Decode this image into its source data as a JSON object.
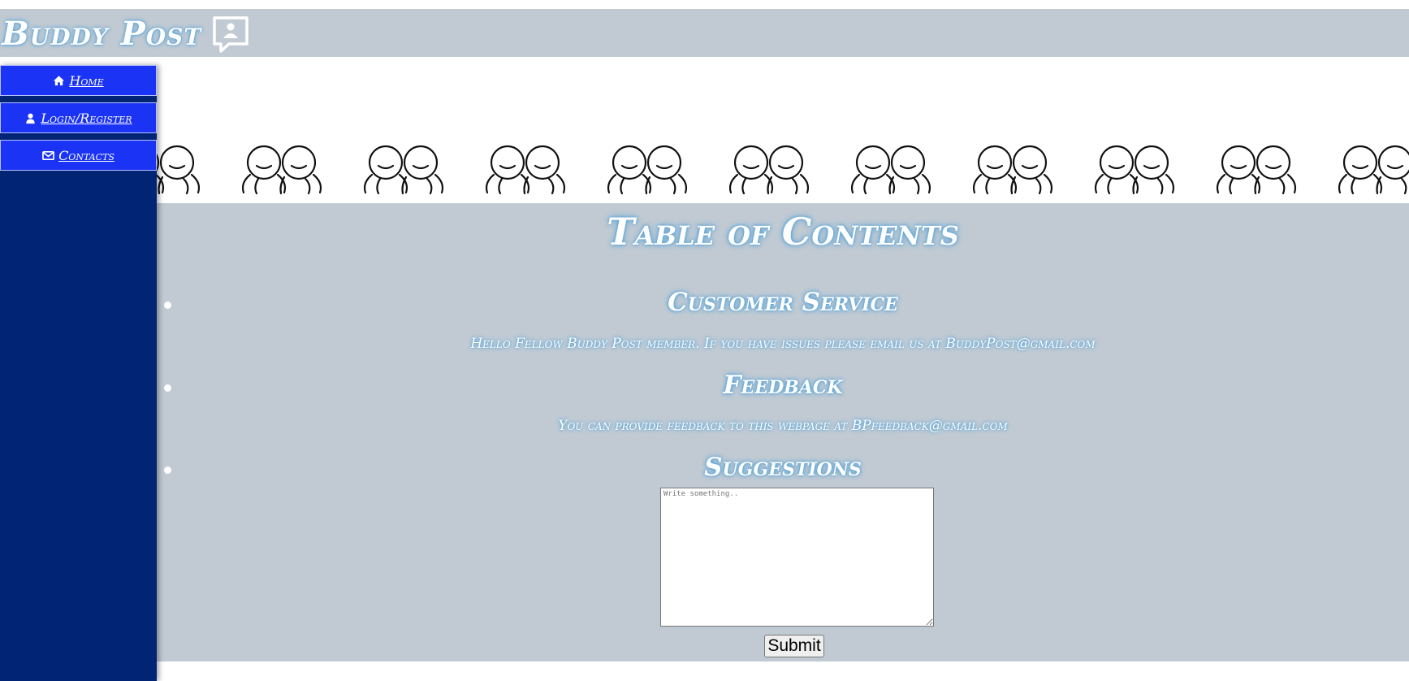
{
  "brand": {
    "title": "Buddy Post",
    "icon": "contact-card-chat-icon"
  },
  "nav": {
    "items": [
      {
        "label": "Home",
        "icon": "home-icon"
      },
      {
        "label": " Login/Register",
        "icon": "user-icon"
      },
      {
        "label": " Contacts",
        "icon": "envelope-icon"
      }
    ]
  },
  "main": {
    "title": "Table of Contents",
    "sections": [
      {
        "heading": "Customer Service",
        "text": "Hello Fellow Buddy Post member. If you have issues please email us at BuddyPost@gmail.com"
      },
      {
        "heading": "Feedback",
        "text": "You can provide feedback to this webpage at BPfeedback@gmail.com"
      },
      {
        "heading": "Suggestions"
      }
    ],
    "suggestion_placeholder": "Write something..",
    "submit_label": "Submit"
  },
  "colors": {
    "header_bg": "#c1cad3",
    "sidebar_bg": "#012574",
    "nav_item_bg": "#1a33f5",
    "glow": "#4b9fd6"
  }
}
